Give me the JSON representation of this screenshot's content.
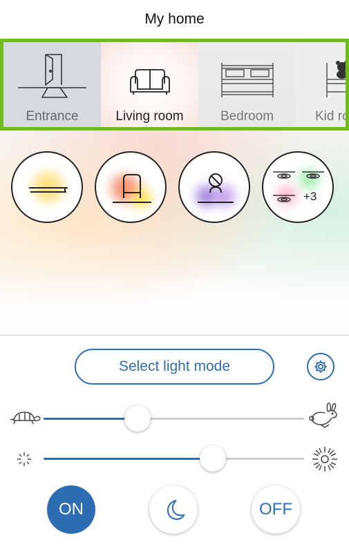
{
  "header": {
    "title": "My home"
  },
  "rooms": [
    {
      "label": "Entrance",
      "icon": "door-icon",
      "selected": false
    },
    {
      "label": "Living room",
      "icon": "sofa-icon",
      "selected": true
    },
    {
      "label": "Bedroom",
      "icon": "bed-icon",
      "selected": false
    },
    {
      "label": "Kid ro",
      "icon": "kids-bed-icon",
      "selected": false
    }
  ],
  "lamps": [
    {
      "name": "ceiling-strip-light",
      "icon": "strip-light-icon"
    },
    {
      "name": "armchair-lamp",
      "icon": "armchair-lamp-icon"
    },
    {
      "name": "table-lamp",
      "icon": "table-lamp-icon"
    },
    {
      "name": "spotlight-group",
      "icon": "spotlights-icon",
      "extra_count": "+3"
    }
  ],
  "controls": {
    "mode_button_label": "Select light mode",
    "speed_slider": {
      "value": 0.36,
      "min_icon": "turtle-icon",
      "max_icon": "rabbit-icon"
    },
    "brightness_slider": {
      "value": 0.65,
      "min_icon": "dim-sun-icon",
      "max_icon": "bright-sun-icon"
    },
    "on_label": "ON",
    "off_label": "OFF"
  },
  "colors": {
    "accent": "#2c6db3",
    "selection_border": "#6fbb1f"
  }
}
